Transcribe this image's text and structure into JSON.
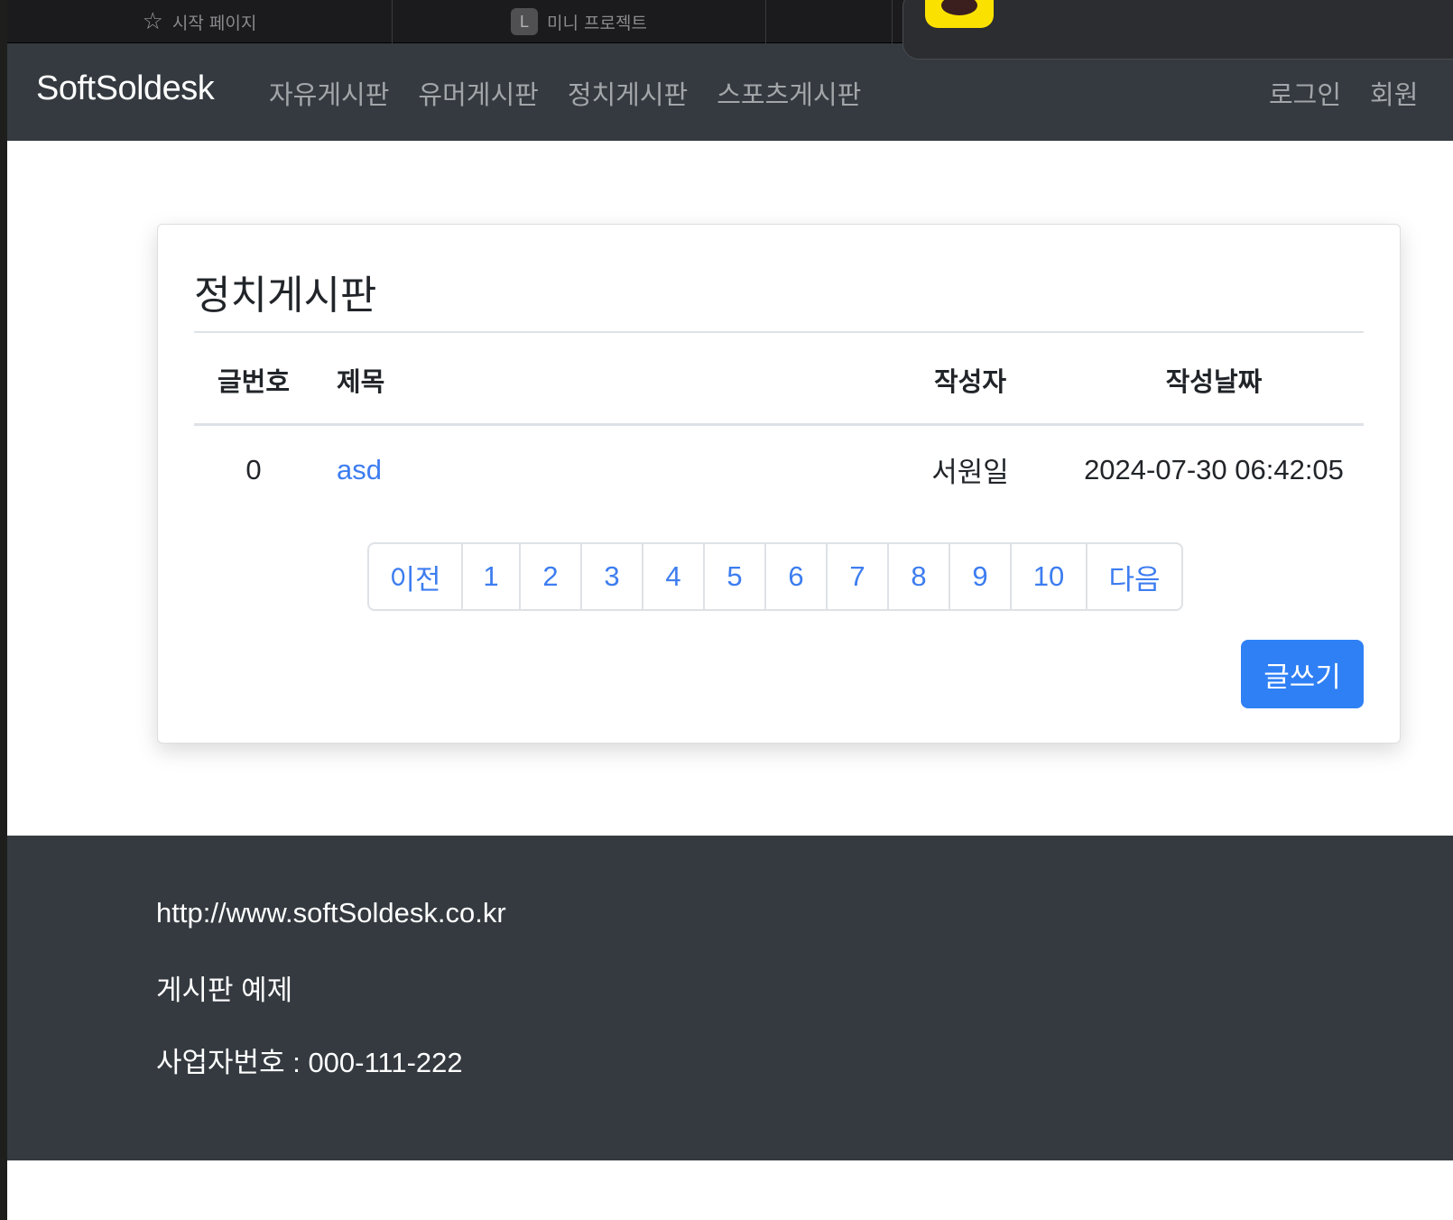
{
  "browser": {
    "tabs": [
      {
        "label": "시작 페이지",
        "icon": "star-icon"
      },
      {
        "label": "미니 프로젝트",
        "icon_letter": "L"
      }
    ]
  },
  "navbar": {
    "brand": "SoftSoldesk",
    "links": [
      "자유게시판",
      "유머게시판",
      "정치게시판",
      "스포츠게시판"
    ],
    "right": [
      "로그인",
      "회원"
    ]
  },
  "board": {
    "title": "정치게시판",
    "columns": [
      "글번호",
      "제목",
      "작성자",
      "작성날짜"
    ],
    "rows": [
      {
        "num": "0",
        "title": "asd",
        "writer": "서원일",
        "date": "2024-07-30 06:42:05"
      }
    ],
    "pagination": {
      "prev": "이전",
      "pages": [
        "1",
        "2",
        "3",
        "4",
        "5",
        "6",
        "7",
        "8",
        "9",
        "10"
      ],
      "next": "다음"
    },
    "write_button": "글쓰기"
  },
  "footer": {
    "url": "http://www.softSoldesk.co.kr",
    "desc": "게시판 예제",
    "biz": "사업자번호 : 000-111-222"
  },
  "colors": {
    "navbar_bg": "#343a40",
    "link": "#3d7df0",
    "primary_button": "#2f80f5"
  }
}
